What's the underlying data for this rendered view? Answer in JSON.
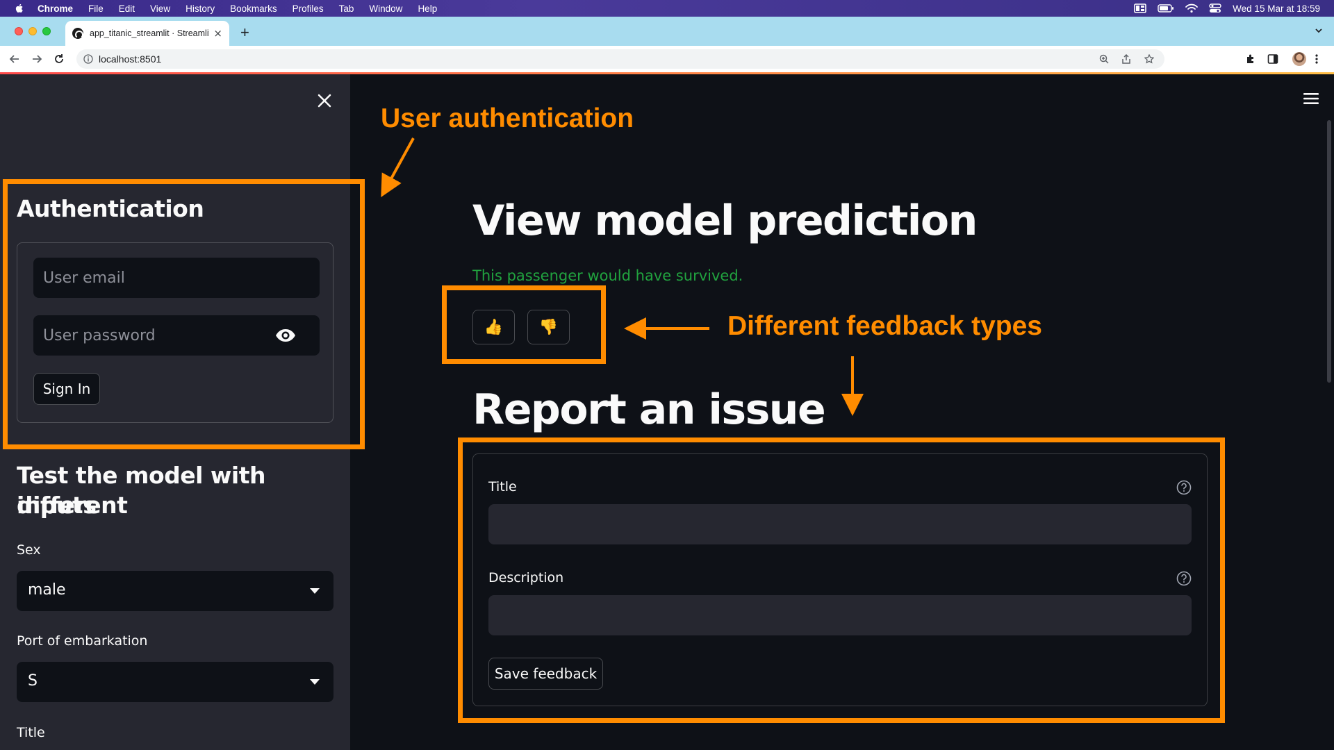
{
  "menubar": {
    "app_name": "Chrome",
    "items": [
      "File",
      "Edit",
      "View",
      "History",
      "Bookmarks",
      "Profiles",
      "Tab",
      "Window",
      "Help"
    ],
    "clock": "Wed 15 Mar at 18:59"
  },
  "browser": {
    "tab_title": "app_titanic_streamlit · Streamlit",
    "tab_close": "×",
    "new_tab": "+",
    "url": "localhost:8501"
  },
  "sidebar": {
    "auth_heading": "Authentication",
    "email_placeholder": "User email",
    "password_placeholder": "User password",
    "sign_in_label": "Sign In",
    "test_heading_line1": "Test the model with different",
    "test_heading_line2": "inputs",
    "sex_label": "Sex",
    "sex_value": "male",
    "port_label": "Port of embarkation",
    "port_value": "S",
    "title_label": "Title"
  },
  "main": {
    "prediction_heading": "View model prediction",
    "prediction_text": "This passenger would have survived.",
    "thumbs_up": "👍",
    "thumbs_down": "👎",
    "report_heading": "Report an issue",
    "form": {
      "title_label": "Title",
      "description_label": "Description",
      "save_label": "Save feedback"
    }
  },
  "annotations": {
    "user_auth": "User authentication",
    "feedback_types": "Different feedback types",
    "color": "#ff8c00"
  },
  "colors": {
    "main_bg": "#0e1117",
    "sidebar_bg": "#262730",
    "success_text": "#21a33f",
    "tabstrip_bg": "#a8dcef"
  }
}
